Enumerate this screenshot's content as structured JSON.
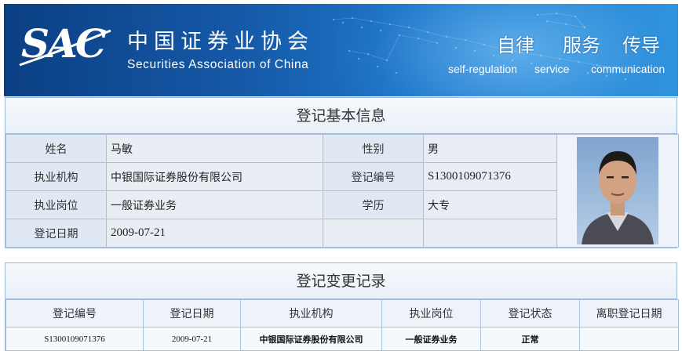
{
  "banner": {
    "logo_text": "SAC",
    "org_name_cn": "中国证券业协会",
    "org_name_en": "Securities Association of China",
    "slogans": [
      {
        "cn": "自律",
        "en": "self-regulation"
      },
      {
        "cn": "服务",
        "en": "service"
      },
      {
        "cn": "传导",
        "en": "communication"
      }
    ]
  },
  "basic_info": {
    "title": "登记基本信息",
    "rows": [
      {
        "label1": "姓名",
        "value1": "马敏",
        "label2": "性别",
        "value2": "男"
      },
      {
        "label1": "执业机构",
        "value1": "中银国际证券股份有限公司",
        "label2": "登记编号",
        "value2": "S1300109071376"
      },
      {
        "label1": "执业岗位",
        "value1": "一般证券业务",
        "label2": "学历",
        "value2": "大专"
      },
      {
        "label1": "登记日期",
        "value1": "2009-07-21",
        "label2": "",
        "value2": ""
      }
    ],
    "photo_alt": "portrait-photo"
  },
  "change_records": {
    "title": "登记变更记录",
    "columns": [
      "登记编号",
      "登记日期",
      "执业机构",
      "执业岗位",
      "登记状态",
      "离职登记日期"
    ],
    "rows": [
      [
        "S1300109071376",
        "2009-07-21",
        "中银国际证券股份有限公司",
        "一般证券业务",
        "正常",
        ""
      ]
    ]
  },
  "colors": {
    "banner_dark": "#0b3f83",
    "banner_light": "#2f93dc",
    "label_bg": "#dfe8f3",
    "border": "#a9c1df"
  }
}
